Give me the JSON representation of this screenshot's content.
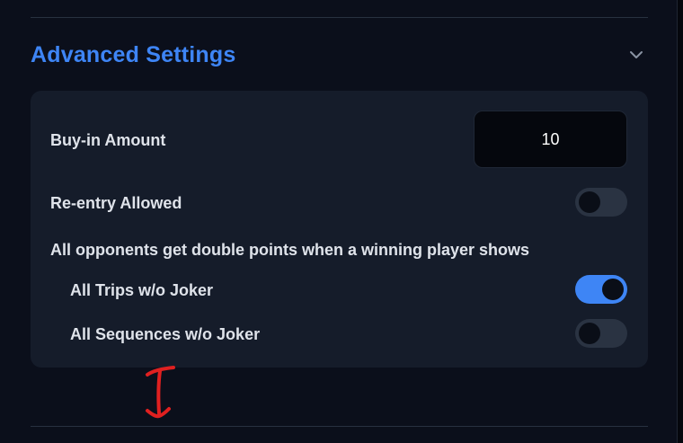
{
  "section": {
    "title": "Advanced Settings",
    "expand_icon": "chevron-down-icon"
  },
  "settings": {
    "buy_in": {
      "label": "Buy-in Amount",
      "value": "10"
    },
    "re_entry": {
      "label": "Re-entry Allowed",
      "enabled": false
    },
    "double_points": {
      "description": "All opponents get double points when a winning player shows",
      "options": [
        {
          "label": "All Trips w/o Joker",
          "enabled": true
        },
        {
          "label": "All Sequences w/o Joker",
          "enabled": false
        }
      ]
    }
  },
  "colors": {
    "accent": "#3e85f5",
    "card_bg": "#151c2a",
    "page_bg": "#0b0f1b",
    "annotation": "#e02020"
  }
}
